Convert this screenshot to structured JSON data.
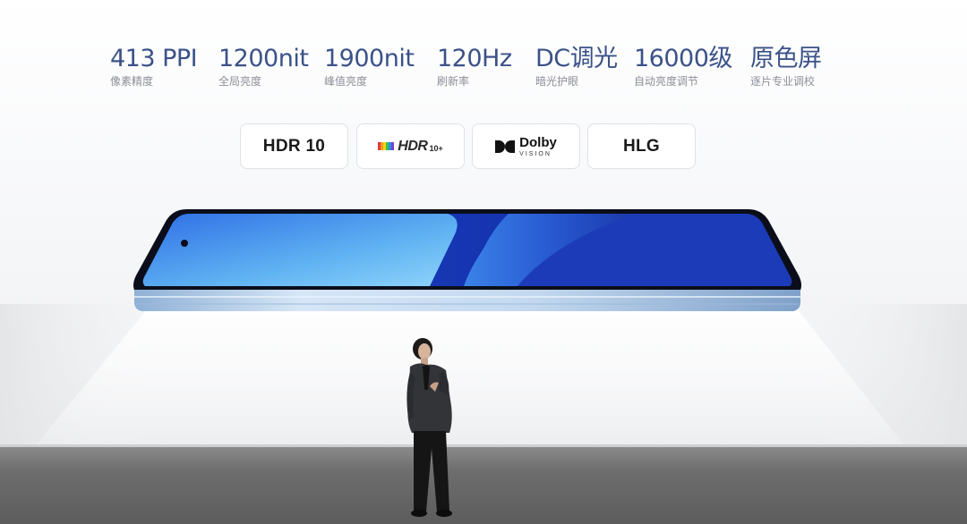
{
  "specs": [
    {
      "value": "413 PPI",
      "caption": "像素精度"
    },
    {
      "value": "1200nit",
      "caption": "全局亮度"
    },
    {
      "value": "1900nit",
      "caption": "峰值亮度"
    },
    {
      "value": "120Hz",
      "caption": "刷新率"
    },
    {
      "value": "DC调光",
      "caption": "暗光护眼"
    },
    {
      "value": "16000级",
      "caption": "自动亮度调节"
    },
    {
      "value": "原色屏",
      "caption": "逐片专业调校"
    }
  ],
  "badges": {
    "hdr10": "HDR 10",
    "hdr10plus": {
      "text": "HDR",
      "plus": "10+"
    },
    "dolby": {
      "line1": "Dolby",
      "line2": "VISION"
    },
    "hlg": "HLG"
  },
  "colors": {
    "spec_text": "#3b5288",
    "caption_text": "#8c8f96",
    "screen_blue": "#1f3fb8",
    "frame_blue": "#b9cde6"
  },
  "icons": {
    "hdr10plus_logo": "hdr10-plus-logo-icon",
    "dolby_logo": "dolby-double-d-icon"
  }
}
